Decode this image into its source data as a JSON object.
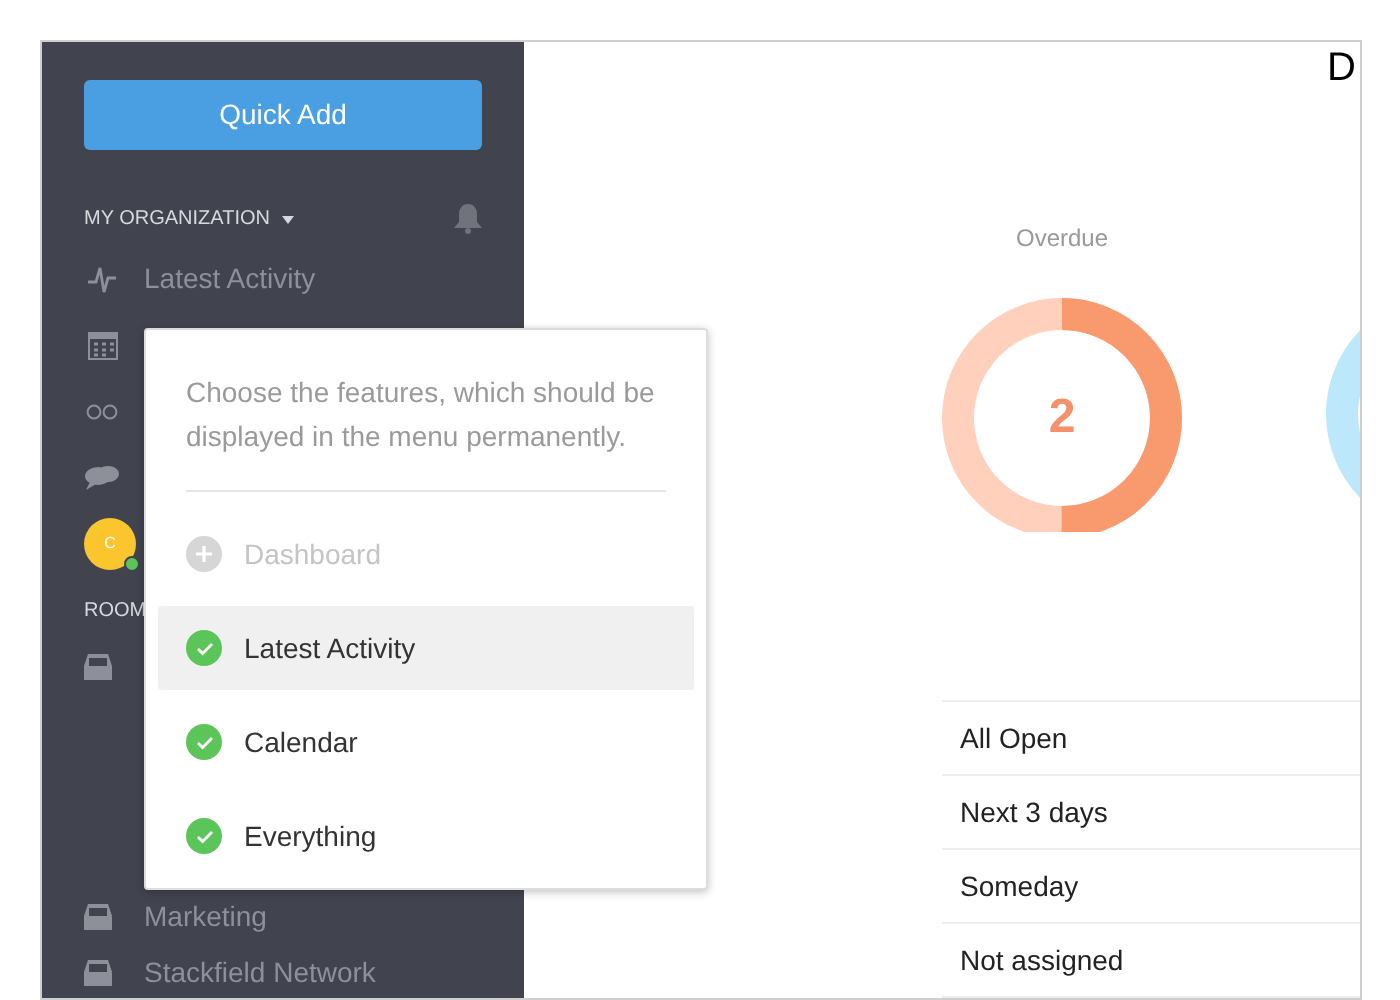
{
  "sidebar": {
    "quick_add": "Quick Add",
    "org_header": "MY ORGANIZATION",
    "nav_items": [
      {
        "kind": "activity",
        "label": "Latest Activity"
      },
      {
        "kind": "calendar"
      },
      {
        "kind": "infinity"
      },
      {
        "kind": "chat"
      },
      {
        "kind": "avatar",
        "initial": "C",
        "online": true
      }
    ],
    "rooms_header": "ROOM",
    "rooms": [
      {
        "kind": "inbox"
      },
      {
        "kind": "inbox",
        "label": "Marketing"
      },
      {
        "kind": "inbox",
        "label": "Stackfield Network"
      }
    ]
  },
  "popover": {
    "description": "Choose the features, which should be displayed in the menu permanently.",
    "items": [
      {
        "label": "Dashboard",
        "checked": false,
        "selected": false
      },
      {
        "label": "Latest Activity",
        "checked": true,
        "selected": true
      },
      {
        "label": "Calendar",
        "checked": true,
        "selected": false
      },
      {
        "label": "Everything",
        "checked": true,
        "selected": false
      }
    ]
  },
  "main": {
    "heading": "D",
    "overdue": {
      "label": "Overdue",
      "value": "2",
      "level": 0.5
    },
    "filters": [
      "All Open",
      "Next 3 days",
      "Someday",
      "Not assigned"
    ]
  }
}
